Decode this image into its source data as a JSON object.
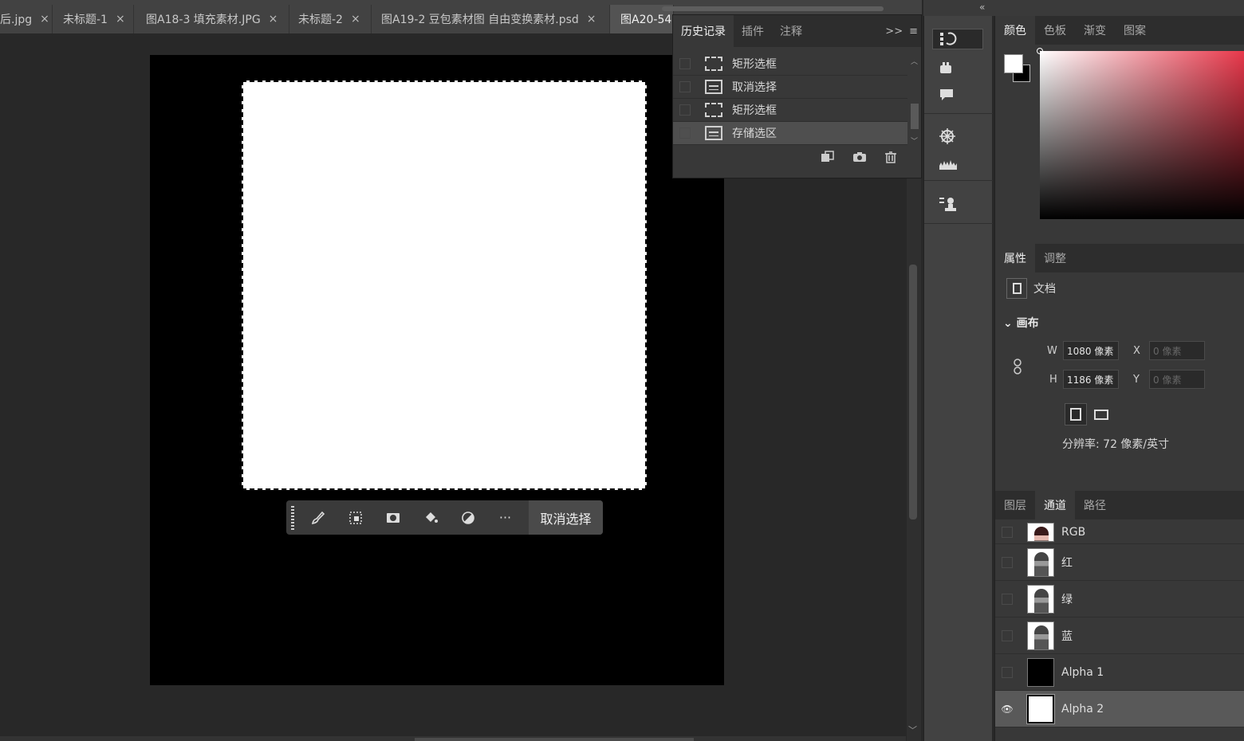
{
  "doc_tabs": [
    {
      "label": "后.jpg",
      "close": "×"
    },
    {
      "label": "未标题-1",
      "close": "×"
    },
    {
      "label": "图A18-3 填充素材.JPG",
      "close": "×"
    },
    {
      "label": "未标题-2",
      "close": "×"
    },
    {
      "label": "图A19-2 豆包素材图 自由变换素材.psd",
      "close": "×"
    },
    {
      "label": "图A20-54",
      "close": ""
    }
  ],
  "context_bar": {
    "icons": [
      "brush-icon",
      "transform-selection-icon",
      "mask-icon",
      "fill-bucket-icon",
      "adjustment-icon",
      "more-icon"
    ],
    "more_glyph": "···",
    "deselect_label": "取消选择"
  },
  "history_panel": {
    "tabs": [
      "历史记录",
      "插件",
      "注释"
    ],
    "active_tab": 0,
    "menu_expand": ">>",
    "menu_glyph": "≡",
    "items": [
      {
        "label": "矩形选框",
        "icon": "marquee-icon"
      },
      {
        "label": "取消选择",
        "icon": "document-icon"
      },
      {
        "label": "矩形选框",
        "icon": "marquee-icon"
      },
      {
        "label": "存储选区",
        "icon": "document-icon"
      }
    ],
    "selected_item": 3,
    "footer_icons": [
      "new-document-from-state-icon",
      "camera-icon",
      "trash-icon"
    ]
  },
  "tool_strip": {
    "collapse": "«",
    "tools": [
      "history-icon",
      "plugin-icon",
      "comment-icon",
      "compass-icon",
      "histogram-icon",
      "clone-source-icon"
    ]
  },
  "color_panel": {
    "tabs": [
      "颜色",
      "色板",
      "渐变",
      "图案"
    ],
    "active_tab": 0,
    "foreground": "#ffffff",
    "background": "#000000",
    "hue_color": "#e8374a"
  },
  "properties_panel": {
    "tabs": [
      "属性",
      "调整"
    ],
    "active_tab": 0,
    "doc_label": "文档",
    "canvas_title": "画布",
    "w_label": "W",
    "w_value": "1080 像素",
    "h_label": "H",
    "h_value": "1186 像素",
    "x_label": "X",
    "x_value": "0 像素",
    "y_label": "Y",
    "y_value": "0 像素",
    "resolution": "分辨率: 72 像素/英寸"
  },
  "channels_panel": {
    "tabs": [
      "图层",
      "通道",
      "路径"
    ],
    "active_tab": 1,
    "channels": [
      {
        "name": "RGB",
        "thumb": "rgb",
        "visible": false
      },
      {
        "name": "红",
        "thumb": "gray",
        "visible": false
      },
      {
        "name": "绿",
        "thumb": "gray",
        "visible": false
      },
      {
        "name": "蓝",
        "thumb": "gray",
        "visible": false
      },
      {
        "name": "Alpha 1",
        "thumb": "black",
        "visible": false
      },
      {
        "name": "Alpha 2",
        "thumb": "white",
        "visible": true
      }
    ],
    "selected_channel": 5,
    "eye_glyph": "👁"
  }
}
